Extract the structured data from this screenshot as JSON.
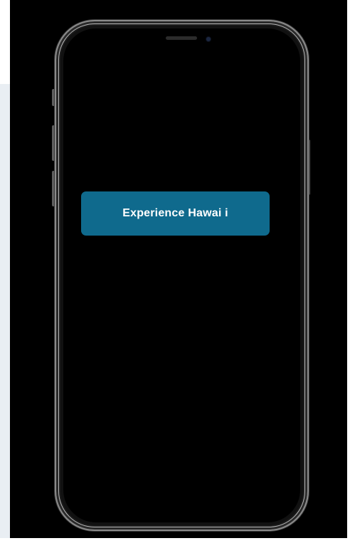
{
  "screen": {
    "cta_label": "Experience Hawai i"
  },
  "colors": {
    "cta_background": "#0f6a8d",
    "cta_text": "#ffffff",
    "screen_background": "#000000",
    "side_panel": "#e9eef3"
  },
  "icons": {
    "speaker": "speaker-grille-icon",
    "camera": "front-camera-icon"
  }
}
